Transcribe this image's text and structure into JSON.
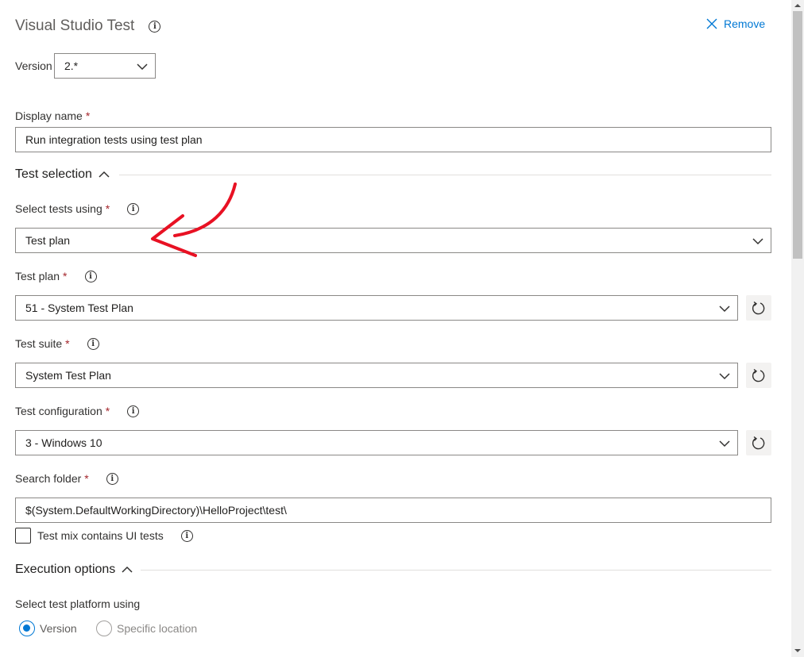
{
  "header": {
    "title": "Visual Studio Test",
    "remove_label": "Remove"
  },
  "version": {
    "label": "Version",
    "value": "2.*"
  },
  "display_name": {
    "label": "Display name",
    "value": "Run integration tests using test plan"
  },
  "sections": {
    "test_selection": "Test selection",
    "execution_options": "Execution options"
  },
  "fields": {
    "select_tests_using": {
      "label": "Select tests using",
      "value": "Test plan"
    },
    "test_plan": {
      "label": "Test plan",
      "value": "51 - System Test Plan"
    },
    "test_suite": {
      "label": "Test suite",
      "value": "System Test Plan"
    },
    "test_configuration": {
      "label": "Test configuration",
      "value": "3 - Windows 10"
    },
    "search_folder": {
      "label": "Search folder",
      "value": "$(System.DefaultWorkingDirectory)\\HelloProject\\test\\"
    }
  },
  "ui_tests_checkbox": {
    "label": "Test mix contains UI tests",
    "checked": false
  },
  "test_platform": {
    "label": "Select test platform using",
    "options": [
      "Version",
      "Specific location"
    ],
    "selected": "Version"
  },
  "required_marker": "*",
  "info_glyph": "i",
  "colors": {
    "accent": "#0078d4",
    "required": "#a4262c",
    "annotation_arrow": "#e81123"
  }
}
